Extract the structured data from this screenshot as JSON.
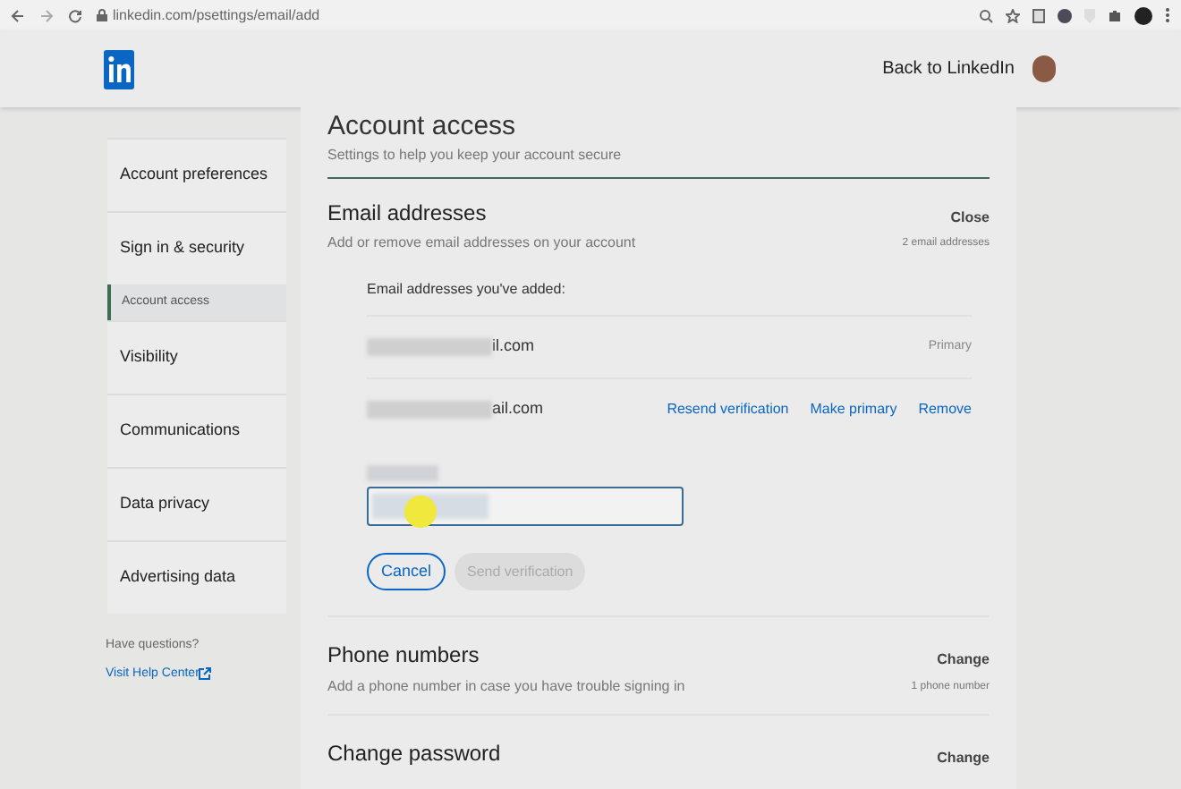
{
  "browser": {
    "url": "linkedin.com/psettings/email/add"
  },
  "header": {
    "back_link": "Back to LinkedIn"
  },
  "sidebar": {
    "items": [
      {
        "label": "Account preferences",
        "kind": "section",
        "selected": false
      },
      {
        "label": "Sign in & security",
        "kind": "section",
        "selected": false
      },
      {
        "label": "Account access",
        "kind": "sub",
        "selected": true
      },
      {
        "label": "Visibility",
        "kind": "section",
        "selected": false
      },
      {
        "label": "Communications",
        "kind": "section",
        "selected": false
      },
      {
        "label": "Data privacy",
        "kind": "section",
        "selected": false
      },
      {
        "label": "Advertising data",
        "kind": "section",
        "selected": false
      }
    ],
    "help": {
      "question": "Have questions?",
      "link": "Visit Help Center"
    }
  },
  "page": {
    "title": "Account access",
    "subtitle": "Settings to help you keep your account secure"
  },
  "email_section": {
    "title": "Email addresses",
    "action": "Close",
    "description": "Add or remove email addresses on your account",
    "count": "2 email addresses",
    "list_heading": "Email addresses you've added:",
    "emails": [
      {
        "visible_text": "il.com",
        "badge": "Primary"
      },
      {
        "visible_text": "ail.com",
        "actions": [
          "Resend verification",
          "Make primary",
          "Remove"
        ]
      }
    ],
    "cancel_button": "Cancel",
    "submit_button": {
      "label": "Send verification",
      "disabled": true
    }
  },
  "sections": [
    {
      "title": "Phone numbers",
      "action": "Change",
      "description": "Add a phone number in case you have trouble signing in",
      "count": "1 phone number"
    },
    {
      "title": "Change password",
      "action": "Change"
    }
  ]
}
